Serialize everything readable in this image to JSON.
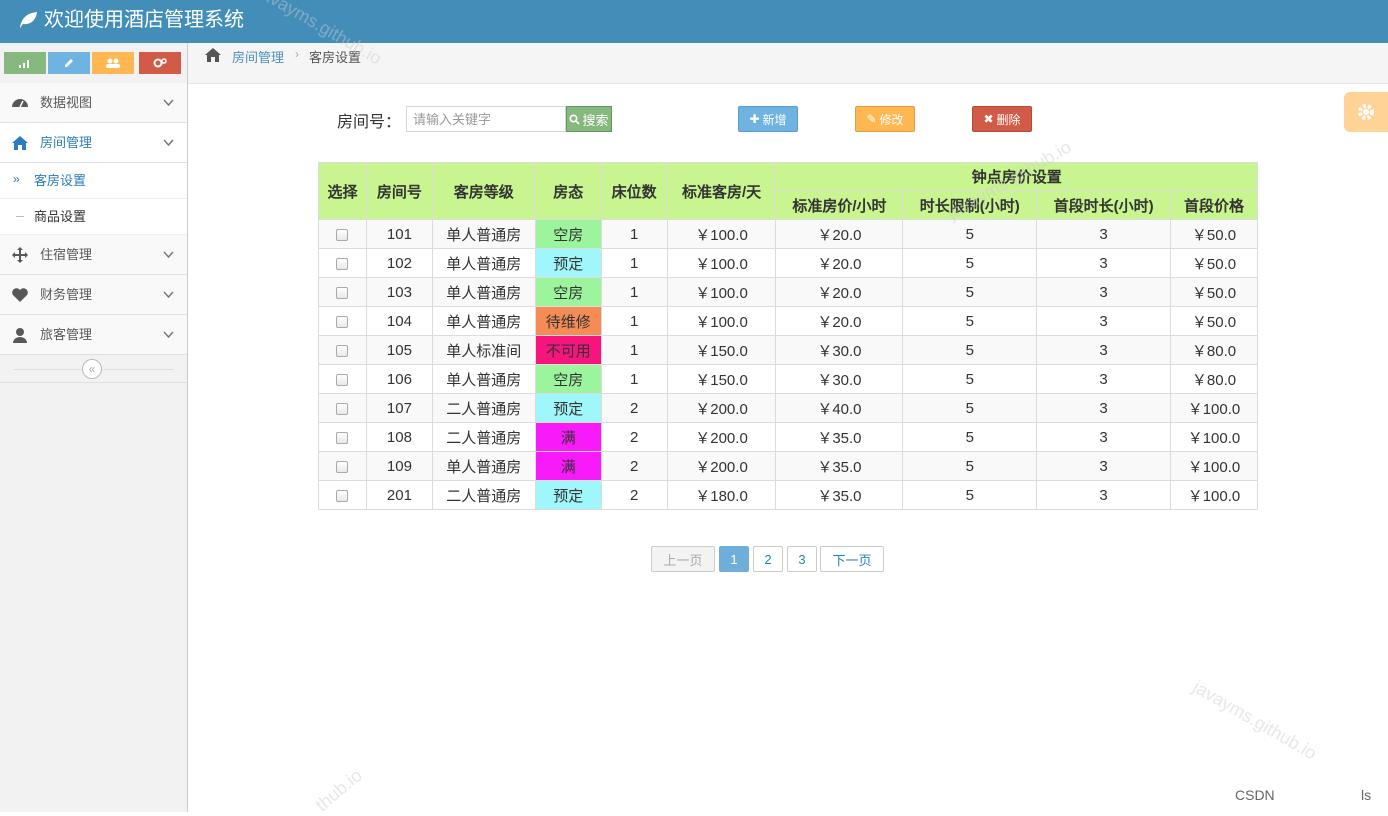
{
  "app": {
    "title": "欢迎使用酒店管理系统"
  },
  "sidebar": {
    "shortcut_colors": [
      "#87b87f",
      "#6fb3e0",
      "#ffb752",
      "#d15b47"
    ],
    "items": [
      {
        "label": "数据视图",
        "icon": "dashboard-icon"
      },
      {
        "label": "房间管理",
        "icon": "home-icon",
        "active": true
      },
      {
        "label": "住宿管理",
        "icon": "move-icon"
      },
      {
        "label": "财务管理",
        "icon": "heart-icon"
      },
      {
        "label": "旅客管理",
        "icon": "user-icon"
      }
    ],
    "sub_items": [
      {
        "label": "客房设置",
        "active": true
      },
      {
        "label": "商品设置"
      }
    ],
    "collapse_symbol": "«"
  },
  "breadcrumb": {
    "parent": "房间管理",
    "separator": "›",
    "current": "客房设置"
  },
  "search": {
    "label": "房间号：",
    "placeholder": "请输入关键字",
    "button": "搜索"
  },
  "actions": {
    "add": "新增",
    "edit": "修改",
    "delete": "删除"
  },
  "table": {
    "group_header": "钟点房价设置",
    "headers": [
      "选择",
      "房间号",
      "客房等级",
      "房态",
      "床位数",
      "标准客房/天",
      "标准房价/小时",
      "时长限制(小时)",
      "首段时长(小时)",
      "首段价格"
    ],
    "status_colors": {
      "空房": "#9cf59c",
      "预定": "#9ff6fb",
      "待维修": "#f58b55",
      "不可用": "#f7147c",
      "满": "#f81af8"
    },
    "rows": [
      {
        "room": "101",
        "level": "单人普通房",
        "status": "空房",
        "beds": "1",
        "day_price": "￥100.0",
        "hour_price": "￥20.0",
        "limit": "5",
        "first_hours": "3",
        "first_price": "￥50.0"
      },
      {
        "room": "102",
        "level": "单人普通房",
        "status": "预定",
        "beds": "1",
        "day_price": "￥100.0",
        "hour_price": "￥20.0",
        "limit": "5",
        "first_hours": "3",
        "first_price": "￥50.0"
      },
      {
        "room": "103",
        "level": "单人普通房",
        "status": "空房",
        "beds": "1",
        "day_price": "￥100.0",
        "hour_price": "￥20.0",
        "limit": "5",
        "first_hours": "3",
        "first_price": "￥50.0"
      },
      {
        "room": "104",
        "level": "单人普通房",
        "status": "待维修",
        "beds": "1",
        "day_price": "￥100.0",
        "hour_price": "￥20.0",
        "limit": "5",
        "first_hours": "3",
        "first_price": "￥50.0"
      },
      {
        "room": "105",
        "level": "单人标准间",
        "status": "不可用",
        "beds": "1",
        "day_price": "￥150.0",
        "hour_price": "￥30.0",
        "limit": "5",
        "first_hours": "3",
        "first_price": "￥80.0"
      },
      {
        "room": "106",
        "level": "单人普通房",
        "status": "空房",
        "beds": "1",
        "day_price": "￥150.0",
        "hour_price": "￥30.0",
        "limit": "5",
        "first_hours": "3",
        "first_price": "￥80.0"
      },
      {
        "room": "107",
        "level": "二人普通房",
        "status": "预定",
        "beds": "2",
        "day_price": "￥200.0",
        "hour_price": "￥40.0",
        "limit": "5",
        "first_hours": "3",
        "first_price": "￥100.0"
      },
      {
        "room": "108",
        "level": "二人普通房",
        "status": "满",
        "beds": "2",
        "day_price": "￥200.0",
        "hour_price": "￥35.0",
        "limit": "5",
        "first_hours": "3",
        "first_price": "￥100.0"
      },
      {
        "room": "109",
        "level": "单人普通房",
        "status": "满",
        "beds": "2",
        "day_price": "￥200.0",
        "hour_price": "￥35.0",
        "limit": "5",
        "first_hours": "3",
        "first_price": "￥100.0"
      },
      {
        "room": "201",
        "level": "二人普通房",
        "status": "预定",
        "beds": "2",
        "day_price": "￥180.0",
        "hour_price": "￥35.0",
        "limit": "5",
        "first_hours": "3",
        "first_price": "￥100.0"
      }
    ]
  },
  "pagination": {
    "prev": "上一页",
    "pages": [
      "1",
      "2",
      "3"
    ],
    "current": "1",
    "next": "下一页"
  },
  "watermark": {
    "text": "javayms.github.io",
    "short": "thub.io",
    "tail": "ithub.io",
    "ithub": "ithub.io"
  },
  "footer": {
    "csdn": "CSDN",
    "tail": "ls"
  }
}
